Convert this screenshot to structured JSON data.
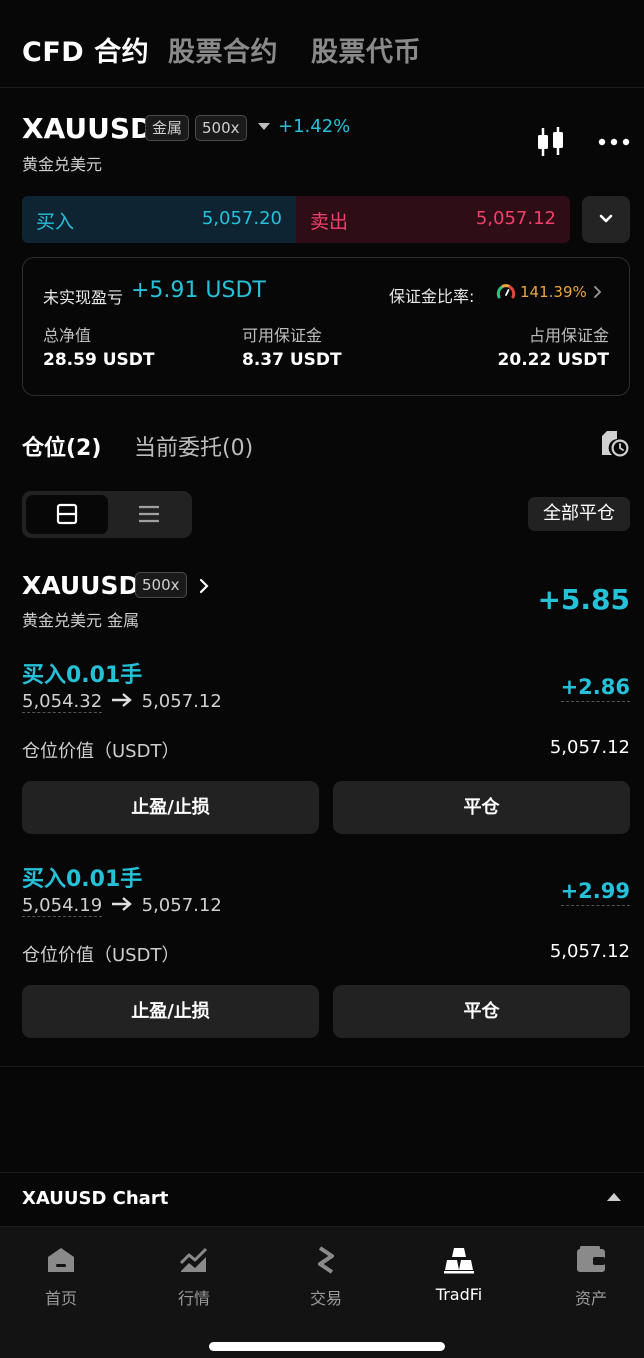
{
  "top_tabs": [
    "CFD 合约",
    "股票合约",
    "股票代币"
  ],
  "symbol": {
    "name": "XAUUSD",
    "category_badge": "金属",
    "leverage_badge": "500x",
    "change_pct": "+1.42%",
    "subtitle": "黄金兑美元"
  },
  "trade": {
    "buy_label": "买入",
    "buy_price": "5,057.20",
    "sell_label": "卖出",
    "sell_price": "5,057.12"
  },
  "summary": {
    "unrealized_label": "未实现盈亏",
    "unrealized_value": "+5.91 USDT",
    "margin_ratio_label": "保证金比率:",
    "margin_ratio_value": "141.39%",
    "stats": [
      {
        "label": "总净值",
        "value": "28.59 USDT"
      },
      {
        "label": "可用保证金",
        "value": "8.37 USDT"
      },
      {
        "label": "占用保证金",
        "value": "20.22 USDT"
      }
    ]
  },
  "positions_tabs": {
    "positions": "仓位(2)",
    "orders": "当前委托(0)"
  },
  "close_all_label": "全部平仓",
  "position": {
    "symbol": "XAUUSD",
    "leverage": "500x",
    "subtitle": "黄金兑美元  金属",
    "total_pnl": "+5.85",
    "lots": [
      {
        "title": "买入0.01手",
        "open_price": "5,054.32",
        "current_price": "5,057.12",
        "pnl": "+2.86",
        "value_label": "仓位价值（USDT）",
        "value": "5,057.12",
        "tpsl_label": "止盈/止损",
        "close_label": "平仓"
      },
      {
        "title": "买入0.01手",
        "open_price": "5,054.19",
        "current_price": "5,057.12",
        "pnl": "+2.99",
        "value_label": "仓位价值（USDT）",
        "value": "5,057.12",
        "tpsl_label": "止盈/止损",
        "close_label": "平仓"
      }
    ]
  },
  "chart_bar_label": "XAUUSD  Chart",
  "nav": [
    {
      "label": "首页",
      "icon": "home-icon"
    },
    {
      "label": "行情",
      "icon": "market-chart-icon"
    },
    {
      "label": "交易",
      "icon": "trade-arrows-icon"
    },
    {
      "label": "TradFi",
      "icon": "gold-bars-icon"
    },
    {
      "label": "资产",
      "icon": "wallet-icon"
    }
  ],
  "colors": {
    "accent_cyan": "#25c1d9",
    "sell_red": "#f0416b",
    "margin_orange": "#e9a63c"
  }
}
